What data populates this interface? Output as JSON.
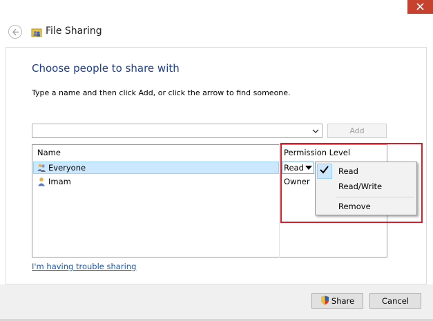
{
  "window": {
    "title": "File Sharing",
    "close_icon": "close-icon",
    "back_icon": "back-arrow-icon",
    "app_icon": "file-sharing-icon"
  },
  "main": {
    "heading": "Choose people to share with",
    "instructions": "Type a name and then click Add, or click the arrow to find someone.",
    "name_input_value": "",
    "add_label": "Add"
  },
  "table": {
    "headers": [
      "Name",
      "Permission Level"
    ],
    "rows": [
      {
        "name": "Everyone",
        "permission": "Read",
        "icon": "group-users-icon",
        "selected": true
      },
      {
        "name": "Imam",
        "permission": "Owner",
        "icon": "user-icon",
        "selected": false
      }
    ]
  },
  "permission_menu": {
    "items": [
      "Read",
      "Read/Write",
      "Remove"
    ],
    "checked": "Read"
  },
  "links": {
    "trouble": "I'm having trouble sharing"
  },
  "footer": {
    "share_label": "Share",
    "cancel_label": "Cancel"
  },
  "colors": {
    "heading": "#1c3f94",
    "link": "#1a57b3",
    "selection": "#cce8ff",
    "highlight_annotation": "#d11f2c",
    "close_button": "#c7412f"
  }
}
